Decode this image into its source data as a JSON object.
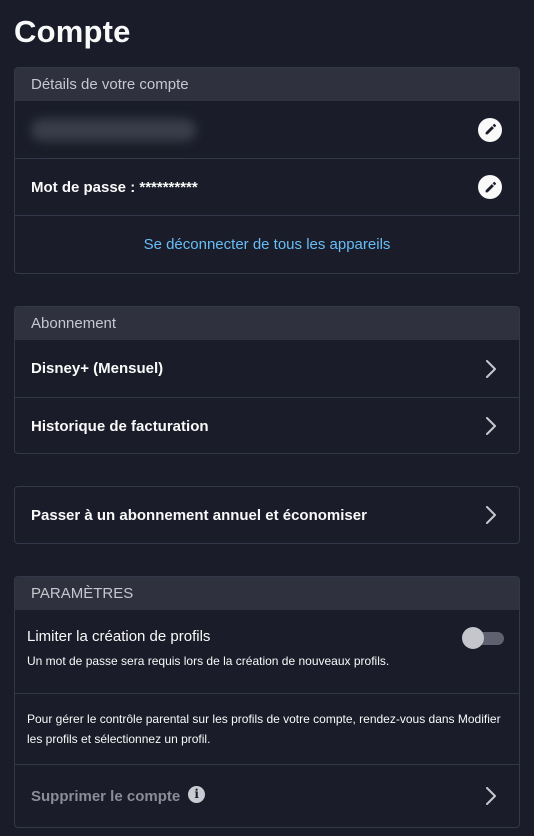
{
  "page": {
    "title": "Compte"
  },
  "account": {
    "header": "Détails de votre compte",
    "password_label": "Mot de passe : **********",
    "logout_all": "Se déconnecter de tous les appareils"
  },
  "subscription": {
    "header": "Abonnement",
    "plan": "Disney+ (Mensuel)",
    "billing": "Historique de facturation"
  },
  "upgrade": {
    "label": "Passer à un abonnement annuel et économiser"
  },
  "settings": {
    "header": "PARAMÈTRES",
    "limit_profiles_title": "Limiter la création de profils",
    "limit_profiles_desc": "Un mot de passe sera requis lors de la création de nouveaux profils.",
    "limit_profiles_enabled": false,
    "parental_note": "Pour gérer le contrôle parental sur les profils de votre compte, rendez-vous dans Modifier les profils et sélectionnez un profil.",
    "delete_account": "Supprimer le compte"
  },
  "colors": {
    "background": "#1a1d29",
    "header_bg": "#2f313e",
    "link": "#67bdf5",
    "muted": "#8a8c97"
  }
}
